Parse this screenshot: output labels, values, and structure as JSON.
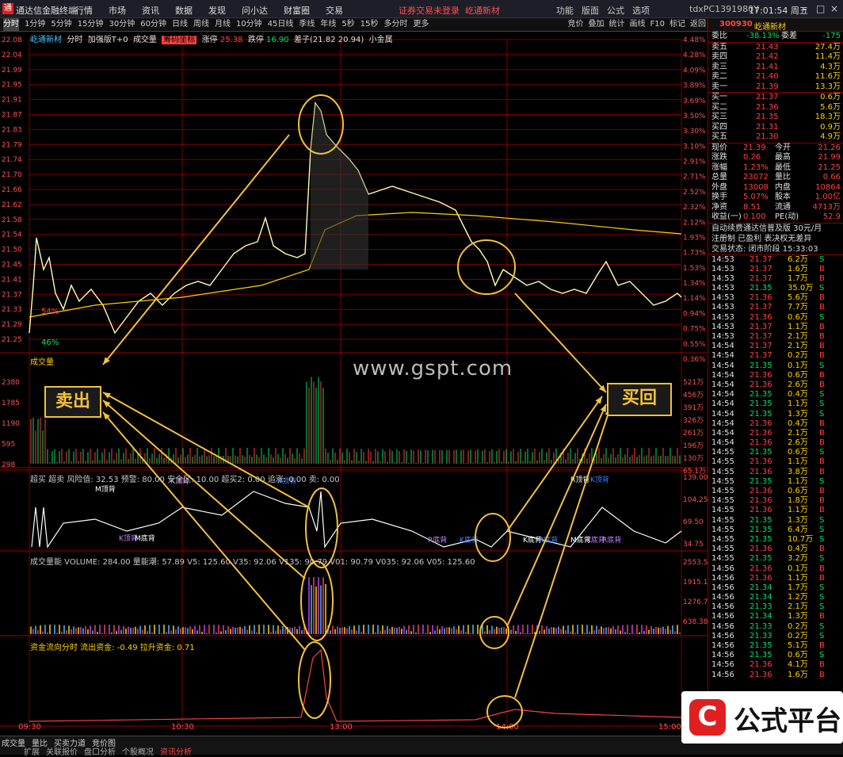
{
  "app": {
    "title": "通达信金融终端",
    "logo": "通",
    "menu": [
      "行情",
      "市场",
      "资讯",
      "数据",
      "发现",
      "问小达",
      "财富圈",
      "交易"
    ],
    "warning": "证券交易未登录",
    "stock_name_tab": "屹通新材",
    "right_menu": [
      "功能",
      "版面",
      "公式",
      "选项"
    ],
    "account": "tdxPC1391980Y",
    "clock": "17:01:54 周五",
    "win_buttons": [
      "–",
      "□",
      "×"
    ]
  },
  "toolbar": {
    "periods": [
      "分时",
      "1分钟",
      "5分钟",
      "15分钟",
      "30分钟",
      "60分钟",
      "日线",
      "周线",
      "月线",
      "10分钟",
      "45日线",
      "季线",
      "年线",
      "5秒",
      "15秒",
      "多分时",
      "更多"
    ],
    "active_period": "分时",
    "tools": [
      "竞价",
      "叠加",
      "统计",
      "画线",
      "F10",
      "标记",
      "返回"
    ]
  },
  "main_info": {
    "name": "屹通新材",
    "mode": "分时",
    "extra": "加强版T+0",
    "vol": "成交量",
    "tag": "筹码坐标",
    "up_label": "涨停",
    "up_val": "25.38",
    "down_label": "跌停",
    "down_val": "16.90",
    "spread": "差子(21.82 20.94)",
    "sector": "小金属"
  },
  "price_axis": {
    "left": [
      "22.08",
      "22.04",
      "21.99",
      "21.95",
      "21.91",
      "21.87",
      "21.83",
      "21.79",
      "21.74",
      "21.70",
      "21.66",
      "21.62",
      "21.58",
      "21.54",
      "21.50",
      "21.45",
      "21.41",
      "21.37",
      "21.33",
      "21.29",
      "21.25"
    ],
    "right": [
      "4.48%",
      "4.28%",
      "4.09%",
      "3.89%",
      "3.69%",
      "3.50%",
      "3.30%",
      "3.10%",
      "2.91%",
      "2.71%",
      "2.52%",
      "2.32%",
      "2.12%",
      "1.93%",
      "1.73%",
      "1.53%",
      "1.34%",
      "1.14%",
      "0.94%",
      "0.75%",
      "0.55%",
      "0.36%"
    ]
  },
  "annotations": {
    "pct_high": "54%",
    "pct_low": "46%",
    "sell_text": "卖出",
    "buy_text": "买回",
    "watermark": "www.gspt.com",
    "tags": [
      "主",
      "卖",
      "卖",
      "主",
      "追都",
      "买",
      "中军",
      "卖",
      "突"
    ]
  },
  "volume_panel": {
    "title": "成交量",
    "axis_left": [
      "2380",
      "1785",
      "1190",
      "595",
      "298"
    ],
    "axis_right": [
      "521万",
      "456万",
      "391万",
      "326万",
      "261万",
      "196万",
      "130万",
      "65.1万"
    ]
  },
  "indicator1": {
    "header": "超买 超卖  风险值: 32.53  预警: 80.00  安全区: 10.00  超买2: 0.00  追涨: 0.00  卖: 0.00",
    "labels": [
      "M顶背",
      "K顶背",
      "R顶背",
      "R顶背",
      "K顶背",
      "K顶背",
      "M底背",
      "R底背",
      "K底背",
      "K底背",
      "R底背",
      "R底背",
      "M底背",
      "K底背"
    ],
    "axis": [
      "139.00",
      "104.25",
      "69.50",
      "34.75"
    ]
  },
  "indicator2": {
    "header": "成交量能 VOLUME: 284.00  量能潮: 57.89  V5: 125.60  V35: 92.06  V135: 90.79  V01: 90.79  V035: 92.06  V05: 125.60",
    "axis": [
      "2553.52",
      "1915.14",
      "1276.76",
      "638.38"
    ]
  },
  "indicator3": {
    "header": "资金流向分时  流出资金: -0.49  拉升资金: 0.71"
  },
  "time_axis": [
    "09:30",
    "10:30",
    "13:00",
    "14:00",
    "15:00"
  ],
  "quote": {
    "code": "300930",
    "name": "屹通新材",
    "weibi": {
      "label": "委比",
      "val": "-38.13%",
      "cmp_label": "委差",
      "cmp": "-175"
    },
    "asks": [
      {
        "label": "卖五",
        "price": "21.43",
        "vol": "27.4万"
      },
      {
        "label": "卖四",
        "price": "21.42",
        "vol": "11.4万"
      },
      {
        "label": "卖三",
        "price": "21.41",
        "vol": "4.3万"
      },
      {
        "label": "卖二",
        "price": "21.40",
        "vol": "11.6万"
      },
      {
        "label": "卖一",
        "price": "21.39",
        "vol": "13.3万"
      }
    ],
    "bids": [
      {
        "label": "买一",
        "price": "21.37",
        "vol": "0.6万"
      },
      {
        "label": "买二",
        "price": "21.36",
        "vol": "5.6万"
      },
      {
        "label": "买三",
        "price": "21.35",
        "vol": "18.3万"
      },
      {
        "label": "买四",
        "price": "21.31",
        "vol": "0.9万"
      },
      {
        "label": "买五",
        "price": "21.30",
        "vol": "4.9万"
      }
    ],
    "stats": [
      {
        "l1": "现价",
        "v1": "21.39",
        "l2": "今开",
        "v2": "21.26"
      },
      {
        "l1": "涨跌",
        "v1": "0.26",
        "l2": "最高",
        "v2": "21.99"
      },
      {
        "l1": "涨幅",
        "v1": "1.23%",
        "l2": "最低",
        "v2": "21.25"
      },
      {
        "l1": "总量",
        "v1": "23072",
        "l2": "量比",
        "v2": "0.66"
      },
      {
        "l1": "外盘",
        "v1": "13008",
        "l2": "内盘",
        "v2": "10864"
      },
      {
        "l1": "换手",
        "v1": "5.07%",
        "l2": "股本",
        "v2": "1.00亿"
      },
      {
        "l1": "净资",
        "v1": "8.51",
        "l2": "流通",
        "v2": "4713万"
      },
      {
        "l1": "收益(一)",
        "v1": "0.100",
        "l2": "PE(动)",
        "v2": "52.9"
      }
    ],
    "messages": [
      "自动续费通达信普及版 30元/月",
      "注册制 已盈利 表决权无差异",
      "交易状态: 闭市阶段 15:33:03"
    ]
  },
  "ticks": [
    {
      "t": "14:53",
      "p": "21.37",
      "v": "6.2万",
      "d": "S"
    },
    {
      "t": "14:53",
      "p": "21.37",
      "v": "1.6万",
      "d": "B"
    },
    {
      "t": "14:53",
      "p": "21.37",
      "v": "1.7万",
      "d": "B"
    },
    {
      "t": "14:53",
      "p": "21.35",
      "v": "35.0万",
      "d": "S"
    },
    {
      "t": "14:53",
      "p": "21.36",
      "v": "5.6万",
      "d": "B"
    },
    {
      "t": "14:53",
      "p": "21.37",
      "v": "7.7万",
      "d": "B"
    },
    {
      "t": "14:53",
      "p": "21.36",
      "v": "0.6万",
      "d": "S"
    },
    {
      "t": "14:53",
      "p": "21.37",
      "v": "1.1万",
      "d": "B"
    },
    {
      "t": "14:53",
      "p": "21.37",
      "v": "2.1万",
      "d": "B"
    },
    {
      "t": "14:54",
      "p": "21.37",
      "v": "2.1万",
      "d": "B"
    },
    {
      "t": "14:54",
      "p": "21.37",
      "v": "0.2万",
      "d": "B"
    },
    {
      "t": "14:54",
      "p": "21.35",
      "v": "0.1万",
      "d": "S"
    },
    {
      "t": "14:54",
      "p": "21.36",
      "v": "0.6万",
      "d": "B"
    },
    {
      "t": "14:54",
      "p": "21.36",
      "v": "2.6万",
      "d": "B"
    },
    {
      "t": "14:54",
      "p": "21.35",
      "v": "0.4万",
      "d": "S"
    },
    {
      "t": "14:54",
      "p": "21.35",
      "v": "1.1万",
      "d": "S"
    },
    {
      "t": "14:54",
      "p": "21.35",
      "v": "1.3万",
      "d": "S"
    },
    {
      "t": "14:54",
      "p": "21.36",
      "v": "0.4万",
      "d": "B"
    },
    {
      "t": "14:54",
      "p": "21.36",
      "v": "2.1万",
      "d": "B"
    },
    {
      "t": "14:54",
      "p": "21.36",
      "v": "2.6万",
      "d": "B"
    },
    {
      "t": "14:55",
      "p": "21.35",
      "v": "0.6万",
      "d": "S"
    },
    {
      "t": "14:55",
      "p": "21.36",
      "v": "1.1万",
      "d": "B"
    },
    {
      "t": "14:55",
      "p": "21.36",
      "v": "3.8万",
      "d": "B"
    },
    {
      "t": "14:55",
      "p": "21.35",
      "v": "1.1万",
      "d": "S"
    },
    {
      "t": "14:55",
      "p": "21.36",
      "v": "0.6万",
      "d": "B"
    },
    {
      "t": "14:55",
      "p": "21.36",
      "v": "1.8万",
      "d": "B"
    },
    {
      "t": "14:55",
      "p": "21.36",
      "v": "1.1万",
      "d": "B"
    },
    {
      "t": "14:55",
      "p": "21.35",
      "v": "1.3万",
      "d": "S"
    },
    {
      "t": "14:55",
      "p": "21.35",
      "v": "6.4万",
      "d": "S"
    },
    {
      "t": "14:55",
      "p": "21.35",
      "v": "10.7万",
      "d": "S"
    },
    {
      "t": "14:55",
      "p": "21.36",
      "v": "0.4万",
      "d": "B"
    },
    {
      "t": "14:55",
      "p": "21.35",
      "v": "3.2万",
      "d": "S"
    },
    {
      "t": "14:56",
      "p": "21.36",
      "v": "0.1万",
      "d": "B"
    },
    {
      "t": "14:56",
      "p": "21.36",
      "v": "1.1万",
      "d": "B"
    },
    {
      "t": "14:56",
      "p": "21.34",
      "v": "1.7万",
      "d": "S"
    },
    {
      "t": "14:56",
      "p": "21.34",
      "v": "1.2万",
      "d": "S"
    },
    {
      "t": "14:56",
      "p": "21.33",
      "v": "2.1万",
      "d": "S"
    },
    {
      "t": "14:56",
      "p": "21.34",
      "v": "1.3万",
      "d": "B"
    },
    {
      "t": "14:56",
      "p": "21.33",
      "v": "0.2万",
      "d": "S"
    },
    {
      "t": "14:56",
      "p": "21.33",
      "v": "0.2万",
      "d": "S"
    },
    {
      "t": "14:56",
      "p": "21.35",
      "v": "5.1万",
      "d": "B"
    },
    {
      "t": "14:56",
      "p": "21.35",
      "v": "0.6万",
      "d": "S"
    },
    {
      "t": "14:56",
      "p": "21.36",
      "v": "4.1万",
      "d": "B"
    },
    {
      "t": "14:56",
      "p": "21.36",
      "v": "1.6万",
      "d": "B"
    }
  ],
  "bottom": {
    "tabs": [
      "成交量",
      "量比",
      "买卖力道",
      "竞价图"
    ],
    "tabs2": [
      "扩展",
      "关联报价",
      "盘口分析",
      "个股概况"
    ],
    "highlight": "资讯分析"
  },
  "badge": {
    "mark": "C",
    "text": "公式平台"
  },
  "colors": {
    "price": "#ffffb0",
    "avg": "#ffd200",
    "up": "#ff4040",
    "down": "#00e060",
    "grid": "#7a0000",
    "annot": "#f2c23a"
  }
}
